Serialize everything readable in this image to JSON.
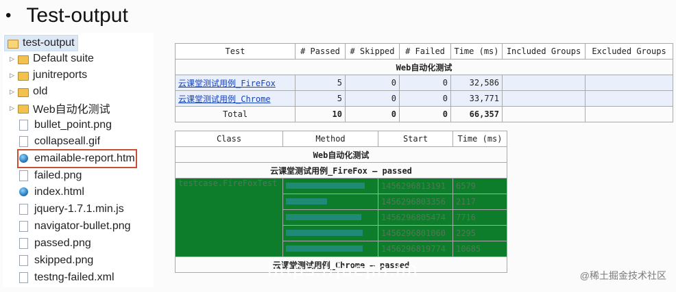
{
  "title": "Test-output",
  "tree": {
    "root": "test-output",
    "items": [
      {
        "label": "Default suite",
        "type": "folder",
        "icon": "folder-icon"
      },
      {
        "label": "junitreports",
        "type": "folder",
        "icon": "folder-icon"
      },
      {
        "label": "old",
        "type": "folder",
        "icon": "folder-icon"
      },
      {
        "label": "Web自动化测试",
        "type": "folder",
        "icon": "folder-icon"
      },
      {
        "label": "bullet_point.png",
        "type": "file",
        "icon": "file-icon"
      },
      {
        "label": "collapseall.gif",
        "type": "file",
        "icon": "file-icon"
      },
      {
        "label": "emailable-report.htm",
        "type": "web",
        "icon": "globe-icon"
      },
      {
        "label": "failed.png",
        "type": "file",
        "icon": "file-icon"
      },
      {
        "label": "index.html",
        "type": "web",
        "icon": "globe-icon"
      },
      {
        "label": "jquery-1.7.1.min.js",
        "type": "file",
        "icon": "file-icon"
      },
      {
        "label": "navigator-bullet.png",
        "type": "file",
        "icon": "file-icon"
      },
      {
        "label": "passed.png",
        "type": "file",
        "icon": "file-icon"
      },
      {
        "label": "skipped.png",
        "type": "file",
        "icon": "file-icon"
      },
      {
        "label": "testng-failed.xml",
        "type": "file",
        "icon": "file-icon"
      }
    ]
  },
  "summary": {
    "headers": [
      "Test",
      "# Passed",
      "# Skipped",
      "# Failed",
      "Time (ms)",
      "Included Groups",
      "Excluded Groups"
    ],
    "suite": "Web自动化测试",
    "rows": [
      {
        "test": "云课堂测试用例_FireFox",
        "passed": "5",
        "skipped": "0",
        "failed": "0",
        "time": "32,586"
      },
      {
        "test": "云课堂测试用例_Chrome",
        "passed": "5",
        "skipped": "0",
        "failed": "0",
        "time": "33,771"
      }
    ],
    "total": {
      "label": "Total",
      "passed": "10",
      "skipped": "0",
      "failed": "0",
      "time": "66,357"
    }
  },
  "detail": {
    "headers": [
      "Class",
      "Method",
      "Start",
      "Time (ms)"
    ],
    "suite": "Web自动化测试",
    "section1": "云课堂测试用例_FireFox — passed",
    "class_name": "testcase.FireFoxTest",
    "starts": [
      "1456296813191",
      "1456296803356",
      "1456296805474",
      "1456296801060",
      "1456296819774"
    ],
    "times": [
      "6579",
      "2117",
      "7716",
      "2295",
      "10685"
    ],
    "section2": "云课堂测试用例_Chrome — passed"
  },
  "overlay_url": "https://juejin.im",
  "watermark": "@稀土掘金技术社区"
}
